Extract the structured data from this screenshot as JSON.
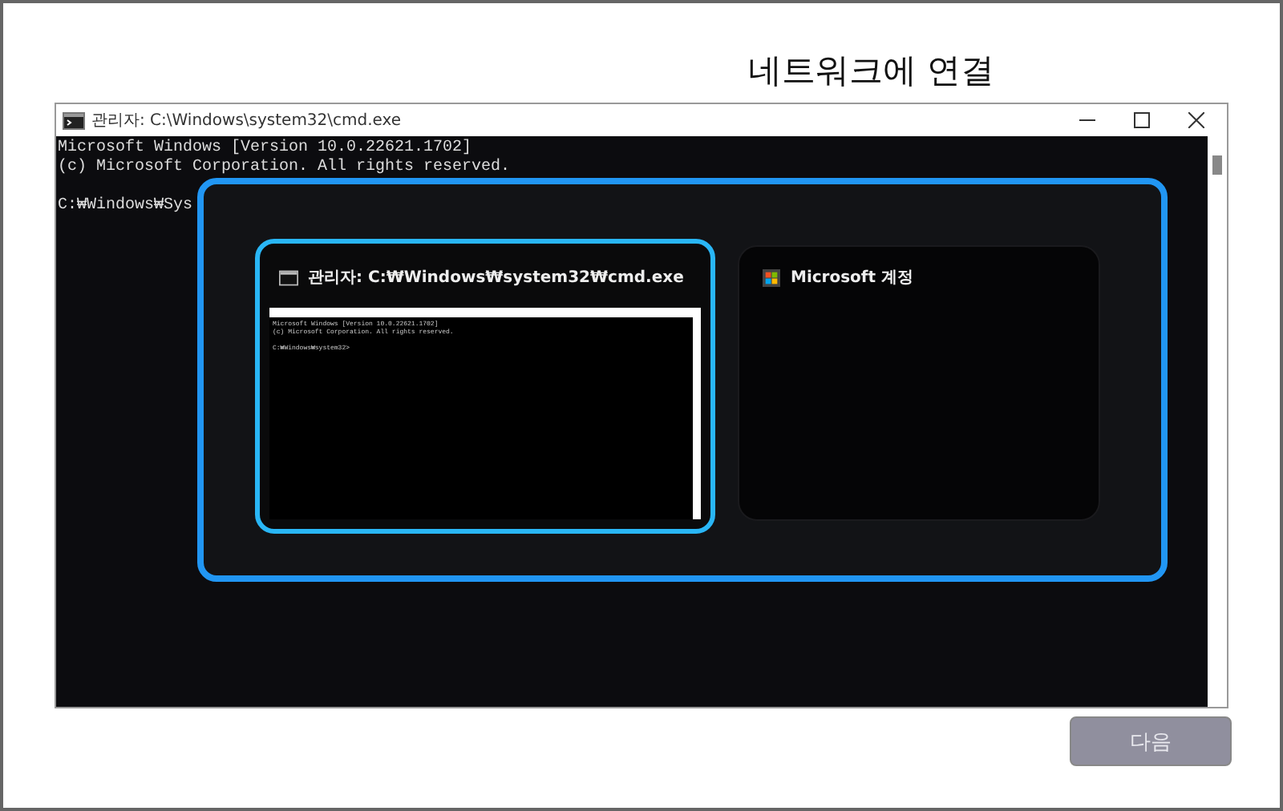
{
  "heading": "네트워크에 연결",
  "console_window": {
    "title": "관리자: C:\\Windows\\system32\\cmd.exe",
    "lines": [
      "Microsoft Windows [Version 10.0.22621.1702]",
      "(c) Microsoft Corporation. All rights reserved."
    ],
    "prompt": "C:₩Windows₩Sys"
  },
  "task_switcher": {
    "windows": [
      {
        "title": "관리자: C:₩Windows₩system32₩cmd.exe",
        "selected": true,
        "kind": "console",
        "lines": [
          "Microsoft Windows [Version 10.0.22621.1702]",
          "(c) Microsoft Corporation. All rights reserved."
        ],
        "prompt": "C:₩Windows₩system32>"
      },
      {
        "title": "Microsoft 계정",
        "selected": false,
        "kind": "account"
      }
    ]
  },
  "buttons": [
    {
      "label": "다음",
      "disabled": true
    }
  ]
}
